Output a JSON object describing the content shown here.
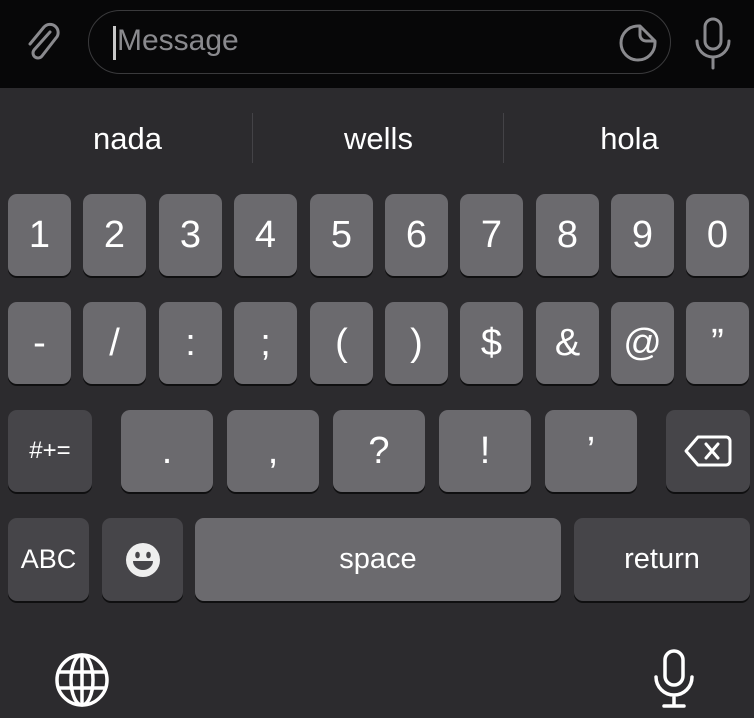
{
  "input_bar": {
    "placeholder": "Message",
    "attach_icon": "paperclip-icon",
    "sticker_icon": "sticker-icon",
    "mic_icon": "microphone-icon"
  },
  "suggestions": [
    "nada",
    "wells",
    "hola"
  ],
  "rows": {
    "numbers": [
      "1",
      "2",
      "3",
      "4",
      "5",
      "6",
      "7",
      "8",
      "9",
      "0"
    ],
    "symbols": [
      "-",
      "/",
      ":",
      ";",
      "(",
      ")",
      "$",
      "&",
      "@",
      "”"
    ],
    "punct": [
      ".",
      ",",
      "?",
      "!",
      "’"
    ]
  },
  "keys": {
    "more_symbols": "#+=",
    "abc": "ABC",
    "space": "space",
    "return": "return",
    "backspace_icon": "backspace-icon",
    "emoji_icon": "emoji-icon"
  },
  "bottom": {
    "globe_icon": "globe-icon",
    "dictation_icon": "microphone-icon"
  },
  "colors": {
    "keyboard_bg": "#2c2b2e",
    "light_key": "#6b6a6e",
    "dark_key": "#464549",
    "top_bg": "#070708"
  }
}
